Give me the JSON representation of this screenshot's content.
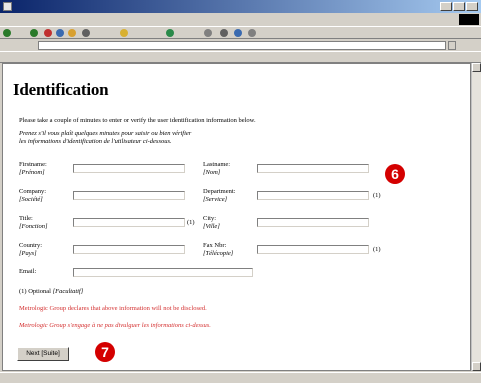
{
  "form": {
    "intro_en": "Please take a couple of minutes to enter or verify the user identification information below.",
    "intro_fr_line1": "Prenez s'il vous plaît quelques minutes pour saisir ou bien vérifier",
    "intro_fr_line2": "les informations d'identification de l'utilisateur ci-dessous.",
    "fields": {
      "firstname": {
        "label": "Firstname:",
        "label_fr": "[Prénom]"
      },
      "lastname": {
        "label": "Lastname:",
        "label_fr": "[Nom]"
      },
      "company": {
        "label": "Company:",
        "label_fr": "[Société]"
      },
      "department": {
        "label": "Department:",
        "label_fr": "[Service]"
      },
      "title": {
        "label": "Title:",
        "label_fr": "[Fonction]"
      },
      "city": {
        "label": "City:",
        "label_fr": "[Ville]"
      },
      "country": {
        "label": "Country:",
        "label_fr": "[Pays]"
      },
      "fax": {
        "label": "Fax Nbr:",
        "label_fr": "[Télécopie]"
      },
      "email": {
        "label": "Email:"
      }
    },
    "optional_marker": "(1)",
    "optional_note": "(1) Optional",
    "optional_note_fr": "[Facultatif]",
    "disclaimer_en": "Metrologic Group declares that above information will not be disclosed.",
    "disclaimer_fr": "Metrologic Group s'engage à ne pas divulguer les informations ci-dessus.",
    "next_button": "Next [Suite]"
  },
  "markers": {
    "form": "6",
    "next": "7"
  },
  "colors": {
    "titlebar": "#0a246a",
    "disclaimer": "#d43030",
    "marker": "#d40000"
  }
}
